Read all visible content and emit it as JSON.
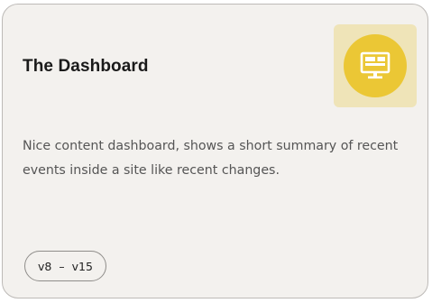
{
  "card": {
    "title": "The Dashboard",
    "description": "Nice content dashboard, shows a short summary of recent events inside a site like recent changes.",
    "icon": "dashboard-monitor-icon",
    "version_from": "v8",
    "version_separator": "–",
    "version_to": "v15"
  },
  "colors": {
    "card_background": "#f3f1ee",
    "icon_tile_background": "#efe4b8",
    "icon_circle": "#ebc735",
    "title_text": "#1a1a1a",
    "body_text": "#555555"
  }
}
